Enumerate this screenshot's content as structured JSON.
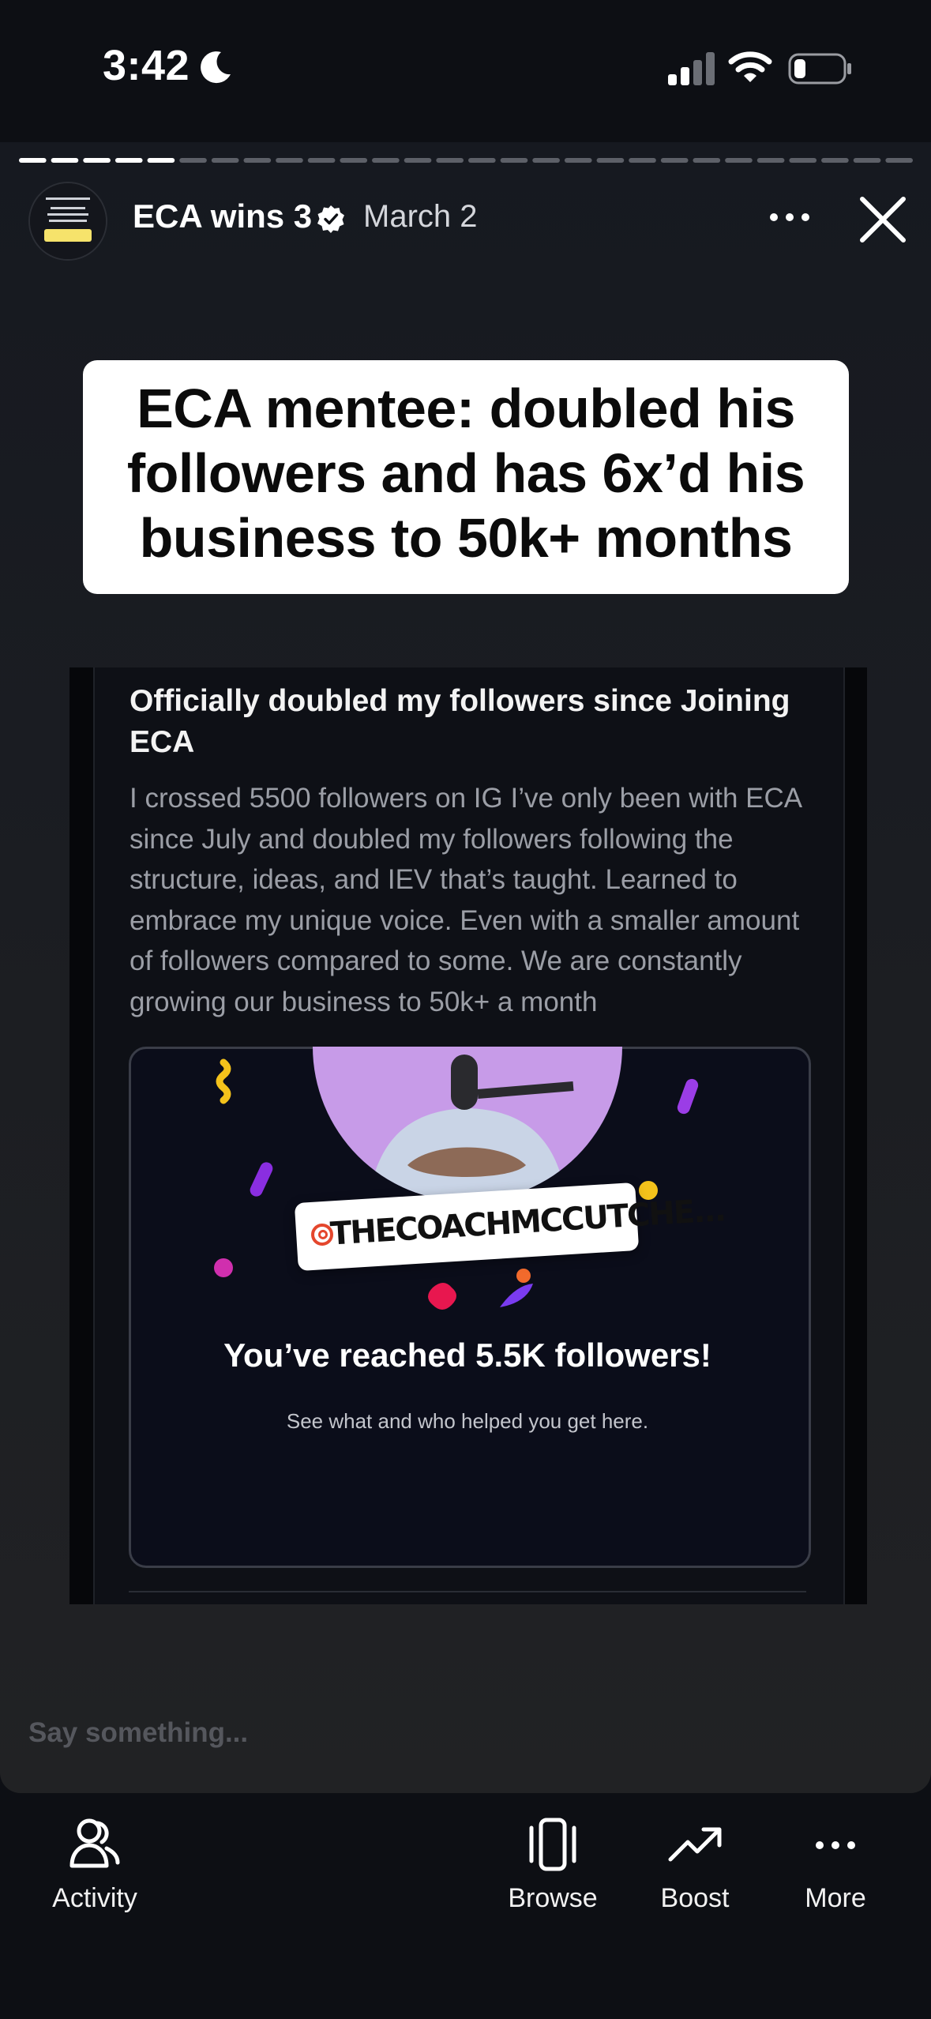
{
  "status_bar": {
    "time": "3:42",
    "icons": [
      "moon-icon",
      "signal-icon",
      "wifi-icon",
      "battery-icon"
    ]
  },
  "story": {
    "username": "ECA wins 3",
    "verified": true,
    "date": "March 2",
    "progress": 0.19,
    "segments": 28,
    "accent": "#ffffff",
    "headline": "ECA mentee: doubled his followers and has 6x’d his business to 50k+ months"
  },
  "post": {
    "title": "Officially doubled my followers since Joining ECA",
    "body": "I crossed 5500 followers on IG I’ve only been with ECA since July and doubled my followers following the structure, ideas, and IEV that’s taught. Learned to embrace my unique voice. Even with a smaller amount of followers compared to some. We are constantly growing our business to 50k+ a month",
    "milestone": {
      "handle": "THECOACHMCCUTCHE...",
      "title": "You’ve reached 5.5K followers!",
      "subtitle": "See what and who helped you get here."
    }
  },
  "reply": {
    "placeholder": "Say something..."
  },
  "nav": {
    "activity": "Activity",
    "browse": "Browse",
    "boost": "Boost",
    "more": "More"
  }
}
